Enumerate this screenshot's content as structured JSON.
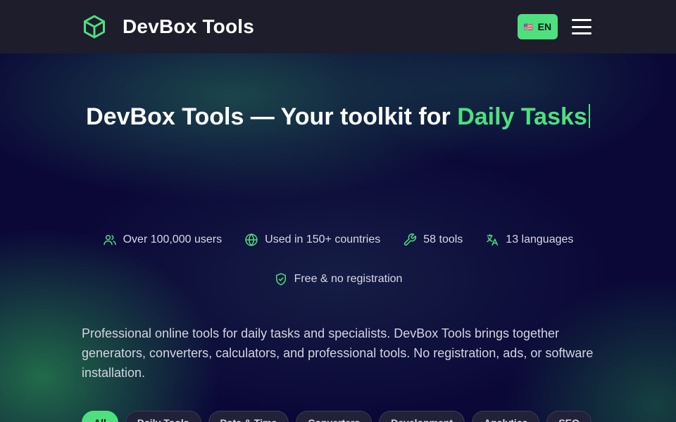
{
  "header": {
    "brand": "DevBox Tools",
    "lang_flag": "🇺🇸",
    "lang_label": "EN",
    "menu_icon": "hamburger-icon",
    "logo_icon": "cube-icon"
  },
  "hero": {
    "title_part1": "DevBox Tools — Your toolkit for",
    "title_highlight": "Daily Tasks"
  },
  "stats": [
    {
      "icon": "users-icon",
      "label": "Over 100,000 users"
    },
    {
      "icon": "globe-icon",
      "label": "Used in 150+ countries"
    },
    {
      "icon": "wrench-icon",
      "label": "58 tools"
    },
    {
      "icon": "translate-icon",
      "label": "13 languages"
    },
    {
      "icon": "shield-check-icon",
      "label": "Free & no registration"
    }
  ],
  "description": "Professional online tools for daily tasks and specialists. DevBox Tools brings together generators, converters, calculators, and professional tools. No registration, ads, or software installation.",
  "categories": [
    "All",
    "Daily Tools",
    "Date & Time",
    "Converters",
    "Development",
    "Analytics",
    "SEO"
  ],
  "colors": {
    "accent": "#4ee07f",
    "header_bg": "#1e1d2b",
    "page_bg": "#0b0838"
  }
}
